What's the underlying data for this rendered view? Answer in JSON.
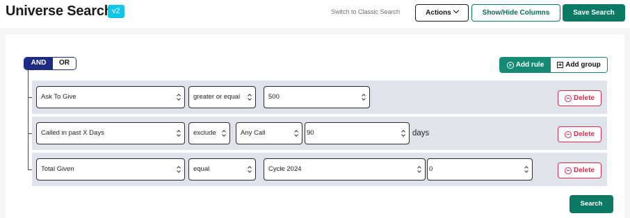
{
  "header": {
    "title": "Universe Search",
    "version_badge": "v2",
    "classic_link": "Switch to Classic Search",
    "actions_label": "Actions",
    "columns_label": "Show/Hide Columns",
    "save_label": "Save Search"
  },
  "query": {
    "combinator": {
      "and_label": "AND",
      "or_label": "OR",
      "selected": "AND"
    },
    "add_rule_label": "Add rule",
    "add_group_label": "Add group",
    "rules": [
      {
        "field": "Ask To Give",
        "operator": "greater or equal",
        "value": "500",
        "delete_label": "Delete"
      },
      {
        "field": "Called in past X Days",
        "operator": "exclude",
        "sub_field": "Any Call",
        "value": "90",
        "unit": "days",
        "delete_label": "Delete"
      },
      {
        "field": "Total Given",
        "operator": "equal",
        "sub_field": "Cycle 2024",
        "value": "0",
        "delete_label": "Delete"
      }
    ],
    "search_label": "Search"
  },
  "colors": {
    "primary_teal": "#0b7a65",
    "combinator_navy": "#1d2b82",
    "badge_cyan": "#0dc6e8",
    "delete_red": "#d62d4a",
    "rule_background": "#dfe4ec"
  },
  "icons": [
    "chevron-down-icon",
    "plus-circle-icon",
    "plus-square-icon",
    "minus-circle-icon",
    "updown-arrows-icon"
  ]
}
